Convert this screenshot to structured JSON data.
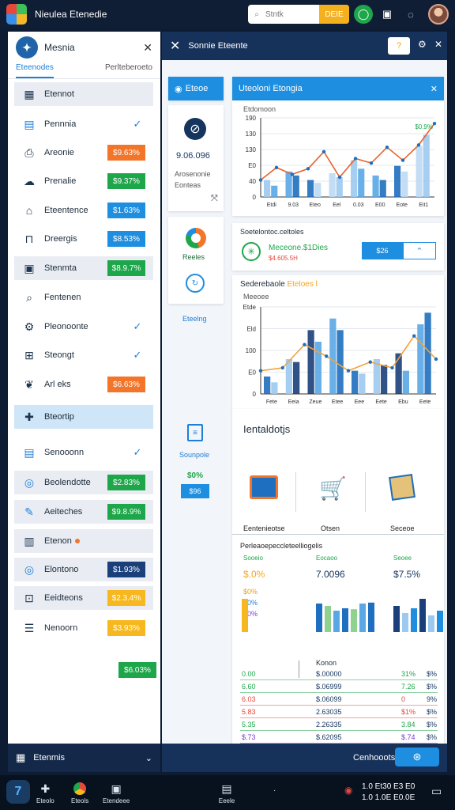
{
  "topbar": {
    "title": "Nieulea Etenedie",
    "search_placeholder": "Stntk",
    "search_button": "DEIE"
  },
  "sidebar": {
    "brand": "Mesnia",
    "tabs": [
      "Eteenodes",
      "Perlteberoeto"
    ],
    "items": [
      {
        "label": "Etennot",
        "icon": "grid-icon",
        "badge": "",
        "badge_color": "",
        "check": false
      },
      {
        "label": "Pennnia",
        "icon": "list-icon",
        "badge": "",
        "badge_color": "",
        "check": true
      },
      {
        "label": "Areonie",
        "icon": "printer-icon",
        "badge": "$9.63%",
        "badge_color": "#f2752a",
        "check": false
      },
      {
        "label": "Prenalie",
        "icon": "cloud-icon",
        "badge": "$9.37%",
        "badge_color": "#1ea64a",
        "check": false
      },
      {
        "label": "Eteentence",
        "icon": "home-icon",
        "badge": "$1.63%",
        "badge_color": "#1e8ee0",
        "check": false
      },
      {
        "label": "Dreergis",
        "icon": "bag-icon",
        "badge": "$8.53%",
        "badge_color": "#1e8ee0",
        "check": false
      },
      {
        "label": "Stenmta",
        "icon": "box-icon",
        "badge": "$8.9.7%",
        "badge_color": "#1ea64a",
        "check": false
      },
      {
        "label": "Fentenen",
        "icon": "search-icon",
        "badge": "",
        "badge_color": "",
        "check": false
      },
      {
        "label": "Pleonoonte",
        "icon": "gear-icon",
        "badge": "",
        "badge_color": "",
        "check": true
      },
      {
        "label": "Steongt",
        "icon": "chip-icon",
        "badge": "",
        "badge_color": "",
        "check": true
      },
      {
        "label": "Arl eks",
        "icon": "leaf-icon",
        "badge": "$6.63%",
        "badge_color": "#f2752a",
        "check": false
      },
      {
        "label": "Bteortip",
        "icon": "puzzle-icon",
        "badge": "",
        "badge_color": "",
        "check": false
      },
      {
        "label": "Senooonn",
        "icon": "document-icon",
        "badge": "",
        "badge_color": "",
        "check": true
      },
      {
        "label": "Beolendotte",
        "icon": "circle-icon",
        "badge": "$2.83%",
        "badge_color": "#1ea64a",
        "check": false
      },
      {
        "label": "Aeiteches",
        "icon": "pencil-icon",
        "badge": "$9.8.9%",
        "badge_color": "#1ea64a",
        "check": false
      },
      {
        "label": "Etenon",
        "icon": "chart-icon",
        "badge": "",
        "badge_color": "",
        "check": false,
        "dot": true
      },
      {
        "label": "Elontono",
        "icon": "target-icon",
        "badge": "$1.93%",
        "badge_color": "#1a3f7a",
        "check": false
      },
      {
        "label": "Eeidteons",
        "icon": "lock-icon",
        "badge": "$2.3.4%",
        "badge_color": "#f6b81e",
        "check": false
      },
      {
        "label": "Nenoorn",
        "icon": "menu-icon",
        "badge": "$3.93%",
        "badge_color": "#f6b81e",
        "check": false
      }
    ],
    "extra_badge": "$6.03%",
    "footer_label": "Etenmis"
  },
  "main": {
    "header_title": "Sonnie Eteente",
    "header_button": "?",
    "left_col": {
      "header": "Eteoe",
      "value": "9.06.096",
      "caption_1": "Arosenonie",
      "caption_2": "Eonteas",
      "item_label": "Reeles",
      "link_label": "Eteelng",
      "doc_label": "Sounpole",
      "pct_label": "$0%",
      "small_button": "$96"
    },
    "chart1": {
      "title": "Uteoloni Etongia",
      "ylabel": "Etdomoon"
    },
    "mid_panel": {
      "title": "Soetelontoc.celtoles",
      "status": "Meceone.$1Dies",
      "sub": "$4.605.5H",
      "button": "$26"
    },
    "chart2": {
      "title": "Sederebaole",
      "title_accent": "Eteloes l",
      "ylabel": "Meeoee"
    },
    "bottom_panel": {
      "title": "Ientaldotjs",
      "products": [
        "Eentenieotse",
        "Otsen",
        "Seceoe"
      ],
      "sub_title": "Perleaoepeccleteelliogelis",
      "columns": [
        {
          "label": "Sooeio",
          "value": "$.0%",
          "lines": [
            "$0%",
            "$0%",
            "$0%"
          ]
        },
        {
          "label": "Eocaoo",
          "value": "7.0096",
          "lines": []
        },
        {
          "label": "Seoee",
          "value": "$7.5%",
          "lines": []
        }
      ],
      "table_header": "Konon",
      "table_rows": [
        {
          "c1": "0.00",
          "c2": "$.00000",
          "c3": "31%",
          "c4": "$%",
          "color": "#1ea64a"
        },
        {
          "c1": "6.60",
          "c2": "$.06999",
          "c3": "7.26",
          "c4": "$%",
          "color": "#1ea64a"
        },
        {
          "c1": "6.03",
          "c2": "$.06099",
          "c3": "0",
          "c4": "9%",
          "color": "#e8483b"
        },
        {
          "c1": "5.83",
          "c2": "2.63035",
          "c3": "$1%",
          "c4": "$%",
          "color": "#e8483b"
        },
        {
          "c1": "5.35",
          "c2": "2.26335",
          "c3": "3.84",
          "c4": "$%",
          "color": "#1ea64a"
        },
        {
          "c1": "$.73",
          "c2": "$.62095",
          "c3": "$.74",
          "c4": "$%",
          "color": "#7a3fd0"
        },
        {
          "c1": "$.53",
          "c2": "$.26239",
          "c3": "$1",
          "c4": "$",
          "color": "#7a3fd0"
        }
      ]
    },
    "footer_label": "Cenhooots"
  },
  "chart_data": [
    {
      "type": "bar",
      "title": "Uteoloni Etongia",
      "xlabel": "",
      "ylabel": "",
      "categories": [
        "Etdi",
        "9.03",
        "Eteo",
        "Eel",
        "0.03",
        "E00",
        "Eote",
        "Eit1"
      ],
      "yticks": [
        "190",
        "130",
        "130",
        "E0",
        "40",
        "0"
      ],
      "series": [
        {
          "values": [
            30,
            45,
            30,
            42,
            65,
            38,
            55,
            90
          ]
        },
        {
          "values": [
            20,
            38,
            25,
            35,
            50,
            30,
            45,
            110
          ]
        }
      ],
      "line": [
        30,
        52,
        40,
        50,
        80,
        35,
        68,
        60,
        88,
        65,
        92,
        130
      ],
      "annotation": "$0.9%"
    },
    {
      "type": "bar",
      "title": "Sederebaole Eteloes l",
      "categories": [
        "Fete",
        "Eeia",
        "Zeue",
        "Etee",
        "Eee",
        "Eete",
        "Ebu",
        "Eete"
      ],
      "yticks": [
        "Etde",
        "Eld",
        "100",
        "E0",
        "0"
      ],
      "series": [
        {
          "values": [
            30,
            60,
            110,
            130,
            40,
            60,
            70,
            120
          ]
        },
        {
          "values": [
            20,
            55,
            90,
            110,
            35,
            50,
            40,
            140
          ]
        }
      ],
      "line": [
        40,
        45,
        85,
        65,
        40,
        55,
        45,
        100,
        60
      ]
    },
    {
      "type": "bar",
      "title": "",
      "series": [
        {
          "values": [
            70,
            50,
            60,
            40,
            50,
            60,
            55
          ]
        },
        {
          "values": [
            60,
            55,
            45,
            50,
            48,
            60,
            62
          ]
        },
        {
          "values": [
            55,
            40,
            50,
            70,
            35,
            45,
            40
          ]
        }
      ]
    }
  ],
  "taskbar": {
    "items": [
      "Eteolo",
      "Eteols",
      "Etendeee",
      "Eeele"
    ],
    "clock_1": "1.0 Et30 E3 E0",
    "clock_2": "1.0 1.0E E0.0E"
  }
}
